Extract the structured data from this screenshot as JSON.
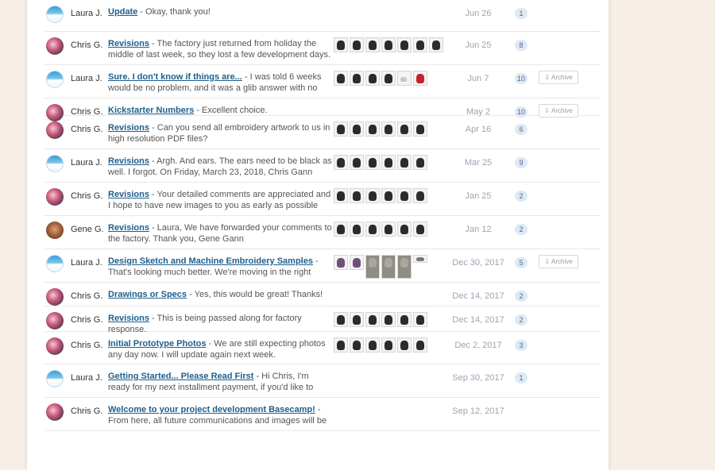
{
  "rows": [
    {
      "author": "Laura J.",
      "avatar": "laura",
      "title": "Update",
      "snippet": " - Okay, thank you!",
      "date": "Jun 26",
      "count": "1",
      "archive": "",
      "thumbs": []
    },
    {
      "author": "Chris G.",
      "avatar": "chris",
      "title": "Revisions",
      "snippet": " - The factory just returned from holiday the middle of last week, so they lost a few development days.",
      "date": "Jun 25",
      "count": "8",
      "archive": "",
      "thumbs": [
        "d",
        "d",
        "d",
        "d",
        "d",
        "d",
        "d"
      ]
    },
    {
      "author": "Laura J.",
      "avatar": "laura",
      "title": "Sure. I don't know if things are...",
      "snippet": " - I was told 6 weeks would be no problem, and it was a glib answer with no real",
      "date": "Jun 7",
      "count": "10",
      "archive": "Archive",
      "thumbs": [
        "d",
        "d",
        "d",
        "d",
        "light",
        "red"
      ]
    },
    {
      "author": "Chris G.",
      "avatar": "chris",
      "title": "Kickstarter Numbers",
      "snippet": " - Excellent choice.",
      "date": "May 2",
      "count": "10",
      "archive": "Archive",
      "thumbs": []
    },
    {
      "author": "Chris G.",
      "avatar": "chris",
      "title": "Revisions",
      "snippet": " - Can you send all embroidery artwork to us in high resolution PDF files?",
      "date": "Apr 16",
      "count": "6",
      "archive": "",
      "thumbs": [
        "d",
        "d",
        "d",
        "d",
        "d",
        "d"
      ]
    },
    {
      "author": "Laura J.",
      "avatar": "laura",
      "title": "Revisions",
      "snippet": " - Argh. And ears. The ears need to be black as well. I forgot. On Friday, March 23, 2018, Chris Gann",
      "date": "Mar 25",
      "count": "9",
      "archive": "",
      "thumbs": [
        "d",
        "d",
        "d",
        "d",
        "d",
        "d"
      ]
    },
    {
      "author": "Chris G.",
      "avatar": "chris",
      "title": "Revisions",
      "snippet": " - Your detailed comments are appreciated and I hope to have new images to you as early as possible next",
      "date": "Jan 25",
      "count": "2",
      "archive": "",
      "thumbs": [
        "d",
        "d",
        "d",
        "d",
        "d",
        "d"
      ]
    },
    {
      "author": "Gene G.",
      "avatar": "gene",
      "title": "Revisions",
      "snippet": " - Laura, We have forwarded your comments to the factory. Thank you, Gene Gann",
      "date": "Jan 12",
      "count": "2",
      "archive": "",
      "thumbs": [
        "d",
        "d",
        "d",
        "d",
        "d",
        "d"
      ]
    },
    {
      "author": "Laura J.",
      "avatar": "laura",
      "title": "Design Sketch and Machine Embroidery Samples",
      "snippet": " - That's looking much better. We're moving in the right",
      "date": "Dec 30, 2017",
      "count": "5",
      "archive": "Archive",
      "thumbs": [
        "sq",
        "sq",
        "tall",
        "tall",
        "tall",
        "wide"
      ]
    },
    {
      "author": "Chris G.",
      "avatar": "chris",
      "title": "Drawings or Specs",
      "snippet": " - Yes, this would be great! Thanks!",
      "date": "Dec 14, 2017",
      "count": "2",
      "archive": "",
      "thumbs": []
    },
    {
      "author": "Chris G.",
      "avatar": "chris",
      "title": "Revisions",
      "snippet": " - This is being passed along for factory response.",
      "date": "Dec 14, 2017",
      "count": "2",
      "archive": "",
      "thumbs": [
        "d",
        "d",
        "d",
        "d",
        "d",
        "d"
      ]
    },
    {
      "author": "Chris G.",
      "avatar": "chris",
      "title": "Initial Prototype Photos",
      "snippet": " - We are still expecting photos any day now. I will update again next week.",
      "date": "Dec 2, 2017",
      "count": "3",
      "archive": "",
      "thumbs": [
        "d",
        "d",
        "d",
        "d",
        "d",
        "d"
      ]
    },
    {
      "author": "Laura J.",
      "avatar": "laura",
      "title": "Getting Started... Please Read First",
      "snippet": " - Hi Chris, I'm ready for my next installment payment, if you'd like to send me an invoice. Thanks, Laura Jennings (Your email is not",
      "date": "Sep 30, 2017",
      "count": "1",
      "archive": "",
      "thumbs": []
    },
    {
      "author": "Chris G.",
      "avatar": "chris",
      "title": "Welcome to your project development Basecamp!",
      "snippet": " - From here, all future communications and images will be shared and discussed.",
      "date": "Sep 12, 2017",
      "count": "",
      "archive": "",
      "thumbs": []
    }
  ]
}
